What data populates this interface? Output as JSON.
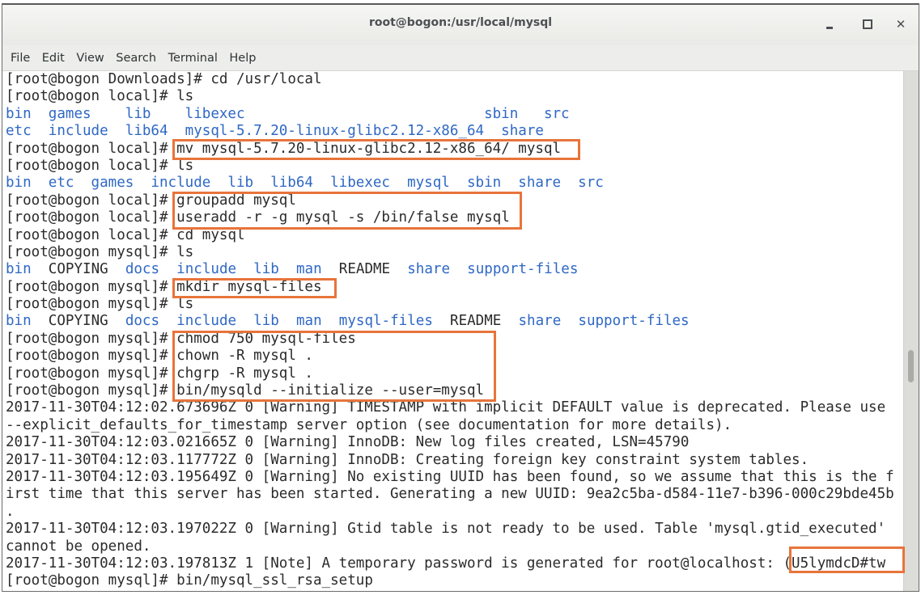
{
  "window": {
    "title": "root@bogon:/usr/local/mysql",
    "controls": {
      "minimize": "minimize-icon",
      "maximize": "maximize-icon",
      "close": "close-icon"
    }
  },
  "menu": [
    "File",
    "Edit",
    "View",
    "Search",
    "Terminal",
    "Help"
  ],
  "terminal": {
    "lines": [
      {
        "type": "cmd",
        "prompt": "[root@bogon Downloads]# ",
        "command": "cd /usr/local"
      },
      {
        "type": "cmd",
        "prompt": "[root@bogon local]# ",
        "command": "ls"
      },
      {
        "type": "ls",
        "text": "bin  games    lib    libexec                            sbin   src"
      },
      {
        "type": "ls",
        "text": "etc  include  lib64  mysql-5.7.20-linux-glibc2.12-x86_64  share"
      },
      {
        "type": "cmd",
        "prompt": "[root@bogon local]# ",
        "command": "mv mysql-5.7.20-linux-glibc2.12-x86_64/ mysql"
      },
      {
        "type": "cmd",
        "prompt": "[root@bogon local]# ",
        "command": "ls"
      },
      {
        "type": "ls",
        "text": "bin  etc  games  include  lib  lib64  libexec  mysql  sbin  share  src"
      },
      {
        "type": "cmd",
        "prompt": "[root@bogon local]# ",
        "command": "groupadd mysql"
      },
      {
        "type": "cmd",
        "prompt": "[root@bogon local]# ",
        "command": "useradd -r -g mysql -s /bin/false mysql"
      },
      {
        "type": "cmd",
        "prompt": "[root@bogon local]# ",
        "command": "cd mysql"
      },
      {
        "type": "cmd",
        "prompt": "[root@bogon mysql]# ",
        "command": "ls"
      },
      {
        "type": "ls-mixed",
        "items": [
          {
            "t": "bin",
            "dir": true
          },
          {
            "t": "  ",
            "dir": false
          },
          {
            "t": "COPYING",
            "dir": false
          },
          {
            "t": "  ",
            "dir": false
          },
          {
            "t": "docs",
            "dir": true
          },
          {
            "t": "  ",
            "dir": false
          },
          {
            "t": "include",
            "dir": true
          },
          {
            "t": "  ",
            "dir": false
          },
          {
            "t": "lib",
            "dir": true
          },
          {
            "t": "  ",
            "dir": false
          },
          {
            "t": "man",
            "dir": true
          },
          {
            "t": "  ",
            "dir": false
          },
          {
            "t": "README",
            "dir": false
          },
          {
            "t": "  ",
            "dir": false
          },
          {
            "t": "share",
            "dir": true
          },
          {
            "t": "  ",
            "dir": false
          },
          {
            "t": "support-files",
            "dir": true
          }
        ]
      },
      {
        "type": "cmd",
        "prompt": "[root@bogon mysql]# ",
        "command": "mkdir mysql-files"
      },
      {
        "type": "cmd",
        "prompt": "[root@bogon mysql]# ",
        "command": "ls"
      },
      {
        "type": "ls-mixed",
        "items": [
          {
            "t": "bin",
            "dir": true
          },
          {
            "t": "  ",
            "dir": false
          },
          {
            "t": "COPYING",
            "dir": false
          },
          {
            "t": "  ",
            "dir": false
          },
          {
            "t": "docs",
            "dir": true
          },
          {
            "t": "  ",
            "dir": false
          },
          {
            "t": "include",
            "dir": true
          },
          {
            "t": "  ",
            "dir": false
          },
          {
            "t": "lib",
            "dir": true
          },
          {
            "t": "  ",
            "dir": false
          },
          {
            "t": "man",
            "dir": true
          },
          {
            "t": "  ",
            "dir": false
          },
          {
            "t": "mysql-files",
            "dir": true
          },
          {
            "t": "  ",
            "dir": false
          },
          {
            "t": "README",
            "dir": false
          },
          {
            "t": "  ",
            "dir": false
          },
          {
            "t": "share",
            "dir": true
          },
          {
            "t": "  ",
            "dir": false
          },
          {
            "t": "support-files",
            "dir": true
          }
        ]
      },
      {
        "type": "cmd",
        "prompt": "[root@bogon mysql]# ",
        "command": "chmod 750 mysql-files"
      },
      {
        "type": "cmd",
        "prompt": "[root@bogon mysql]# ",
        "command": "chown -R mysql ."
      },
      {
        "type": "cmd",
        "prompt": "[root@bogon mysql]# ",
        "command": "chgrp -R mysql ."
      },
      {
        "type": "cmd",
        "prompt": "[root@bogon mysql]# ",
        "command": "bin/mysqld --initialize --user=mysql"
      },
      {
        "type": "out",
        "text": "2017-11-30T04:12:02.673696Z 0 [Warning] TIMESTAMP with implicit DEFAULT value is deprecated. Please use"
      },
      {
        "type": "out",
        "text": "--explicit_defaults_for_timestamp server option (see documentation for more details)."
      },
      {
        "type": "out",
        "text": "2017-11-30T04:12:03.021665Z 0 [Warning] InnoDB: New log files created, LSN=45790"
      },
      {
        "type": "out",
        "text": "2017-11-30T04:12:03.117772Z 0 [Warning] InnoDB: Creating foreign key constraint system tables."
      },
      {
        "type": "out",
        "text": "2017-11-30T04:12:03.195649Z 0 [Warning] No existing UUID has been found, so we assume that this is the f"
      },
      {
        "type": "out",
        "text": "irst time that this server has been started. Generating a new UUID: 9ea2c5ba-d584-11e7-b396-000c29bde45b"
      },
      {
        "type": "out",
        "text": "."
      },
      {
        "type": "out",
        "text": "2017-11-30T04:12:03.197022Z 0 [Warning] Gtid table is not ready to be used. Table 'mysql.gtid_executed'"
      },
      {
        "type": "out",
        "text": "cannot be opened."
      },
      {
        "type": "out",
        "text": "2017-11-30T04:12:03.197813Z 1 [Note] A temporary password is generated for root@localhost: (U5lymdcD#tw"
      },
      {
        "type": "cmd",
        "prompt": "[root@bogon mysql]# ",
        "command": "bin/mysql_ssl_rsa_setup"
      }
    ],
    "highlighted_password": "(U5lymdcD#tw"
  },
  "colors": {
    "highlight": "#e8743b",
    "directory": "#2f68c4",
    "text": "#2b2b2b"
  }
}
